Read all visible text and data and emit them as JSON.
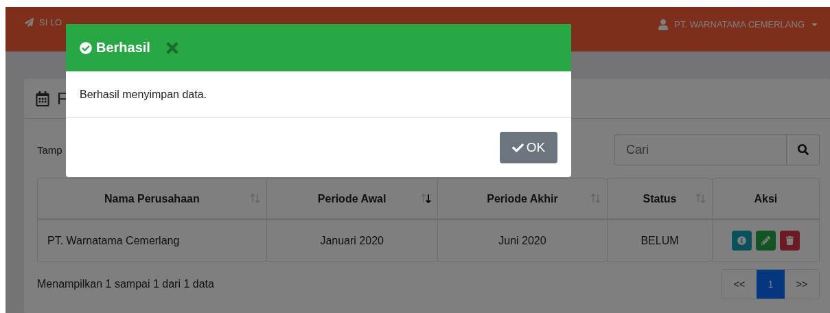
{
  "navbar": {
    "brand": "SI LO",
    "user": "PT. WARNATAMA CEMERLANG"
  },
  "card": {
    "title": "F",
    "length_label": "Tamp",
    "search": {
      "placeholder": "Cari"
    },
    "table": {
      "columns": [
        {
          "label": "Nama Perusahaan",
          "sortable": true,
          "sorted_descending": false
        },
        {
          "label": "Periode Awal",
          "sortable": true,
          "sorted_descending": true
        },
        {
          "label": "Periode Akhir",
          "sortable": true,
          "sorted_descending": false
        },
        {
          "label": "Status",
          "sortable": true,
          "sorted_descending": false
        },
        {
          "label": "Aksi",
          "sortable": false
        }
      ],
      "rows": [
        {
          "cells": [
            "PT. Warnatama Cemerlang",
            "Januari 2020",
            "Juni 2020",
            "BELUM"
          ],
          "actions": [
            {
              "kind": "info"
            },
            {
              "kind": "edit"
            },
            {
              "kind": "delete"
            }
          ]
        }
      ]
    },
    "info": "Menampilkan 1 sampai 1 dari 1 data",
    "pagination": [
      {
        "label": "<<",
        "selected": false
      },
      {
        "label": "1",
        "selected": true
      },
      {
        "label": ">>",
        "selected": false
      }
    ]
  },
  "modal": {
    "title": "Berhasil",
    "message": "Berhasil menyimpan data.",
    "button": "OK"
  }
}
